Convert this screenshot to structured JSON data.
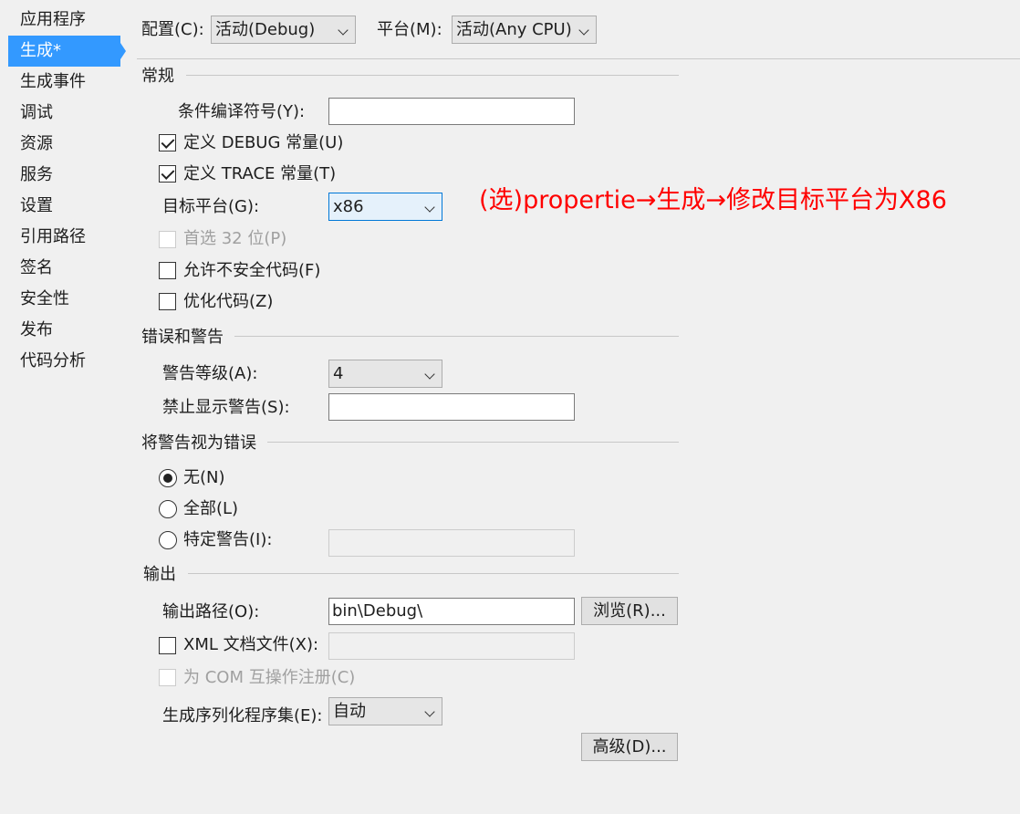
{
  "sidebar": {
    "items": [
      {
        "label": "应用程序"
      },
      {
        "label": "生成*"
      },
      {
        "label": "生成事件"
      },
      {
        "label": "调试"
      },
      {
        "label": "资源"
      },
      {
        "label": "服务"
      },
      {
        "label": "设置"
      },
      {
        "label": "引用路径"
      },
      {
        "label": "签名"
      },
      {
        "label": "安全性"
      },
      {
        "label": "发布"
      },
      {
        "label": "代码分析"
      }
    ]
  },
  "toolbar": {
    "config_label": "配置(C):",
    "config_value": "活动(Debug)",
    "platform_label": "平台(M):",
    "platform_value": "活动(Any CPU)"
  },
  "general": {
    "title": "常规",
    "conditional_symbols_label": "条件编译符号(Y):",
    "conditional_symbols_value": "",
    "define_debug_label": "定义 DEBUG 常量(U)",
    "define_debug_checked": true,
    "define_trace_label": "定义 TRACE 常量(T)",
    "define_trace_checked": true,
    "target_platform_label": "目标平台(G):",
    "target_platform_value": "x86",
    "prefer32_label": "首选 32 位(P)",
    "prefer32_checked": false,
    "unsafe_label": "允许不安全代码(F)",
    "unsafe_checked": false,
    "optimize_label": "优化代码(Z)",
    "optimize_checked": false
  },
  "errors": {
    "title": "错误和警告",
    "warning_level_label": "警告等级(A):",
    "warning_level_value": "4",
    "suppress_label": "禁止显示警告(S):",
    "suppress_value": ""
  },
  "treat_warnings": {
    "title": "将警告视为错误",
    "none_label": "无(N)",
    "all_label": "全部(L)",
    "specific_label": "特定警告(I):",
    "selected": "none",
    "specific_value": ""
  },
  "output": {
    "title": "输出",
    "path_label": "输出路径(O):",
    "path_value": "bin\\Debug\\",
    "browse_label": "浏览(R)...",
    "xml_doc_label": "XML 文档文件(X):",
    "xml_doc_checked": false,
    "xml_doc_value": "",
    "com_label": "为 COM 互操作注册(C)",
    "com_checked": false,
    "serialization_label": "生成序列化程序集(E):",
    "serialization_value": "自动",
    "advanced_label": "高级(D)..."
  },
  "annotation": {
    "text": "(选)propertie→生成→修改目标平台为X86",
    "color": "#ff0000"
  },
  "colors": {
    "accent": "#3399ff",
    "background": "#f0f0f0"
  }
}
